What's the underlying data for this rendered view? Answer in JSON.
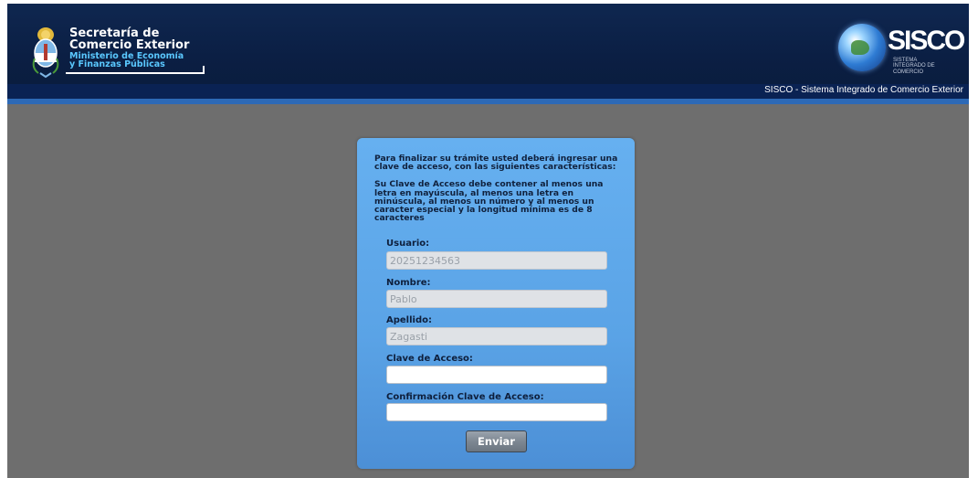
{
  "header": {
    "org_line1": "Secretaría de",
    "org_line2": "Comercio Exterior",
    "ministry_line1": "Ministerio de Economía",
    "ministry_line2": "y Finanzas Públicas",
    "brand": "SISCO",
    "brand_sub": "SISTEMA INTEGRADO DE COMERCIO",
    "subtitle": "SISCO - Sistema Integrado de Comercio Exterior"
  },
  "form": {
    "intro": "Para finalizar su trámite usted deberá ingresar una clave de acceso, con las siguientes características:",
    "rules": "Su Clave de Acceso debe contener al menos una letra en mayúscula, al menos una letra en minúscula, al menos un número y al menos un caracter especial y la longitud mínima es de 8 caracteres",
    "fields": {
      "usuario": {
        "label": "Usuario:",
        "value": "20251234563"
      },
      "nombre": {
        "label": "Nombre:",
        "value": "Pablo"
      },
      "apellido": {
        "label": "Apellido:",
        "value": "Zagasti"
      },
      "clave": {
        "label": "Clave de Acceso:",
        "value": ""
      },
      "confirmacion": {
        "label": "Confirmación Clave de Acceso:",
        "value": ""
      }
    },
    "submit_label": "Enviar"
  },
  "colors": {
    "header_bg": "#0b1f44",
    "header_stripe": "#2d69b6",
    "page_bg": "#6e6e6e",
    "panel_bg": "#5aa3e6"
  }
}
